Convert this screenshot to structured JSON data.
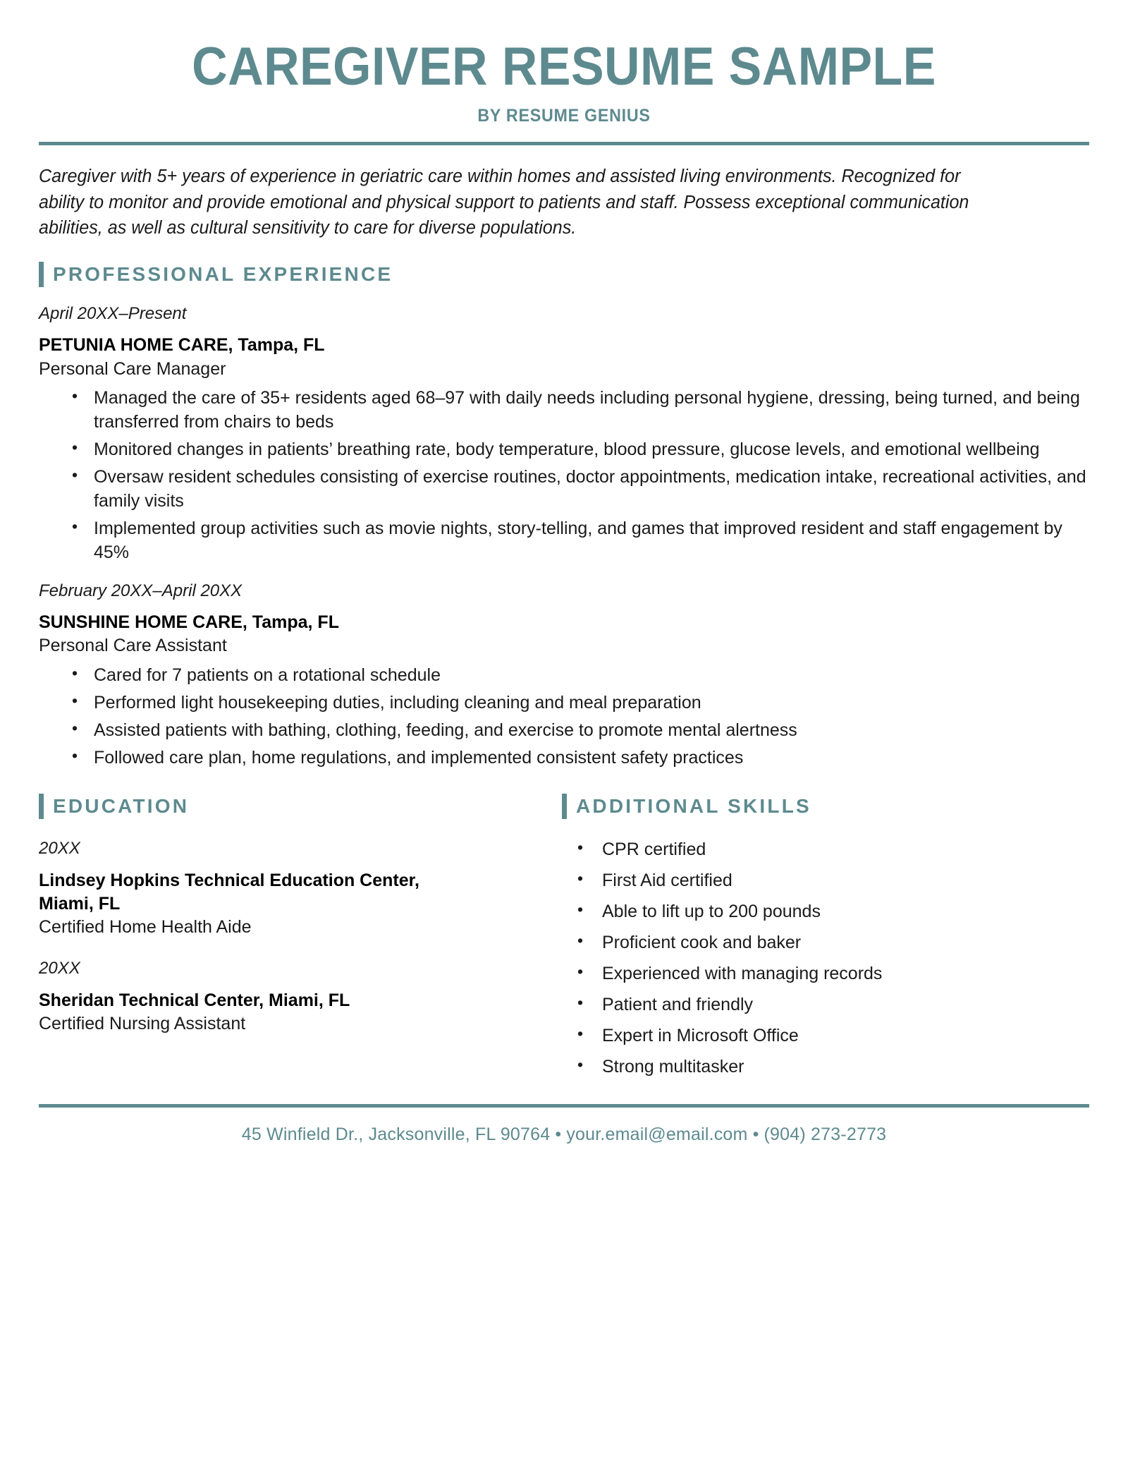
{
  "theme": {
    "accent": "#5d8a8f",
    "text": "#1a1a1a",
    "background": "#ffffff"
  },
  "header": {
    "title": "CAREGIVER RESUME SAMPLE",
    "byline": "BY RESUME GENIUS"
  },
  "summary": "Caregiver with 5+ years of experience in geriatric care within homes and assisted living environments. Recognized for ability to monitor and provide emotional and physical support to patients and staff. Possess exceptional communication abilities, as well as cultural sensitivity to care for diverse populations.",
  "sections": {
    "experience": {
      "heading": "PROFESSIONAL EXPERIENCE",
      "jobs": [
        {
          "dates": "April 20XX–Present",
          "company": "PETUNIA HOME CARE, Tampa, FL",
          "role": "Personal Care Manager",
          "bullets": [
            "Managed the care of 35+ residents aged 68–97 with daily needs including personal hygiene, dressing, being turned, and being transferred from chairs to beds",
            "Monitored changes in patients’ breathing rate, body temperature, blood pressure, glucose levels, and emotional wellbeing",
            "Oversaw resident schedules consisting of exercise routines, doctor appointments, medication intake, recreational activities, and family visits",
            "Implemented group activities such as movie nights, story-telling, and games that improved resident and staff engagement by 45%"
          ]
        },
        {
          "dates": "February 20XX–April 20XX",
          "company": "SUNSHINE HOME CARE, Tampa, FL",
          "role": "Personal Care Assistant",
          "bullets": [
            "Cared for 7 patients on a rotational schedule",
            "Performed light housekeeping duties, including cleaning and meal preparation",
            "Assisted patients with bathing, clothing, feeding, and exercise to promote mental alertness",
            "Followed care plan, home regulations, and implemented consistent safety practices"
          ]
        }
      ]
    },
    "education": {
      "heading": "EDUCATION",
      "entries": [
        {
          "year": "20XX",
          "school": "Lindsey Hopkins Technical Education Center, Miami, FL",
          "degree": "Certified Home Health Aide"
        },
        {
          "year": "20XX",
          "school": "Sheridan Technical Center, Miami, FL",
          "degree": "Certified Nursing Assistant"
        }
      ]
    },
    "skills": {
      "heading": "ADDITIONAL SKILLS",
      "items": [
        "CPR certified",
        "First Aid certified",
        "Able to lift up to 200 pounds",
        "Proficient cook and baker",
        "Experienced with managing records",
        "Patient and friendly",
        "Expert in Microsoft Office",
        "Strong multitasker"
      ]
    }
  },
  "footer": {
    "address": "45 Winfield Dr., Jacksonville, FL 90764",
    "separator": "•",
    "email": "your.email@email.com",
    "phone": "(904) 273-2773"
  }
}
